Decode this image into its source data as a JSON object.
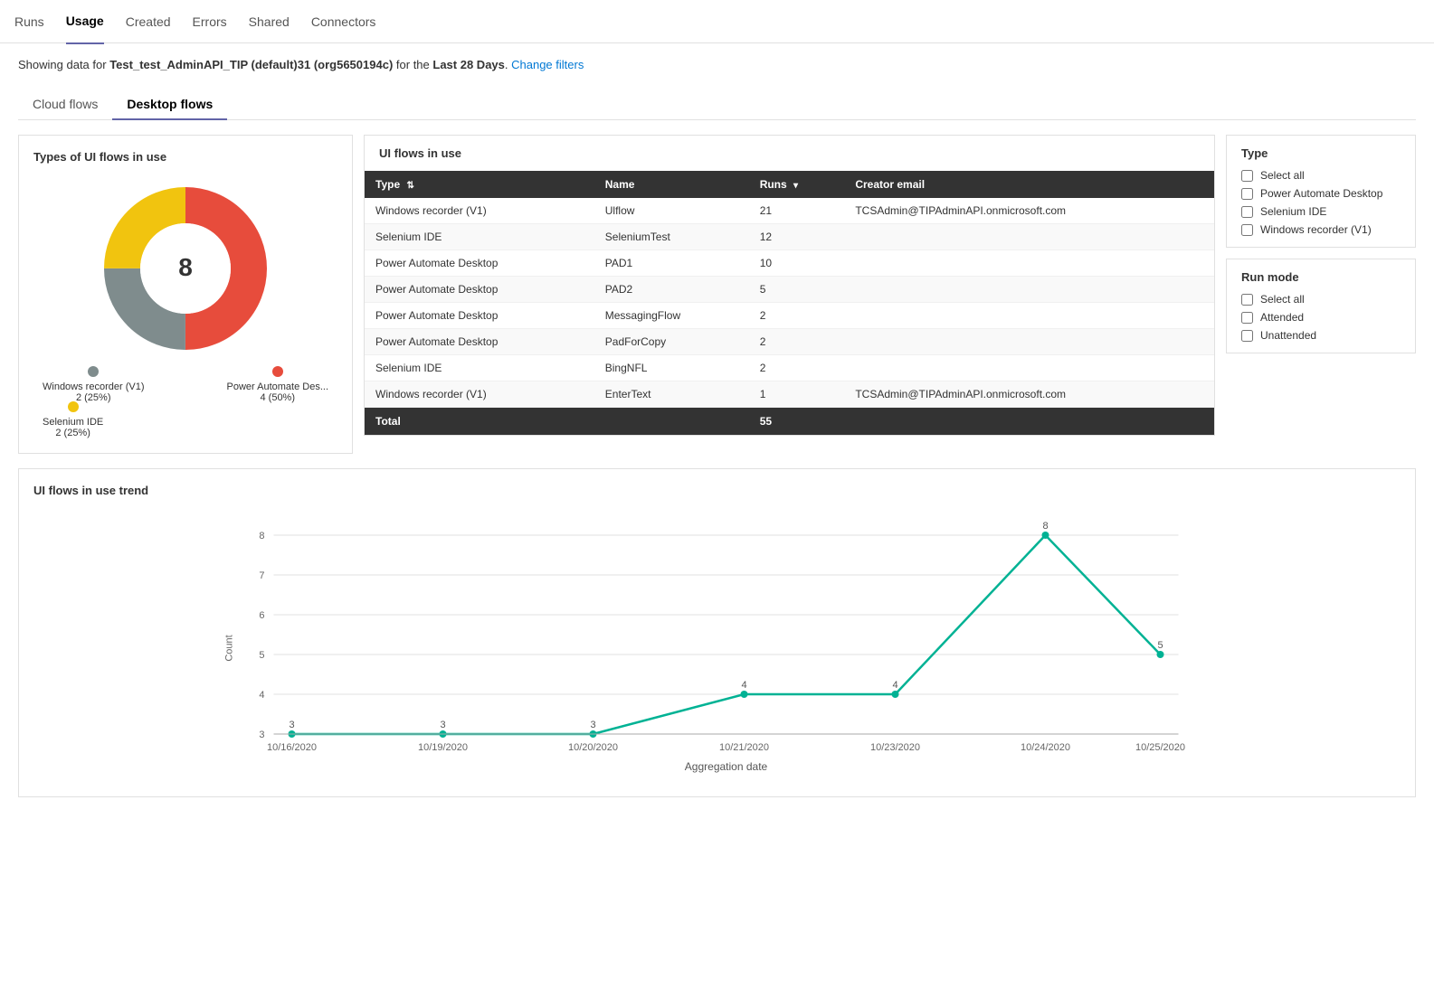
{
  "nav": {
    "items": [
      {
        "label": "Runs",
        "active": false
      },
      {
        "label": "Usage",
        "active": true
      },
      {
        "label": "Created",
        "active": false
      },
      {
        "label": "Errors",
        "active": false
      },
      {
        "label": "Shared",
        "active": false
      },
      {
        "label": "Connectors",
        "active": false
      }
    ]
  },
  "info_bar": {
    "prefix": "Showing data for",
    "env_name": "Test_test_AdminAPI_TIP (default)31 (org5650194c)",
    "middle": "for the",
    "period": "Last 28 Days",
    "suffix": ".",
    "change_link": "Change filters"
  },
  "tabs": [
    {
      "label": "Cloud flows",
      "active": false
    },
    {
      "label": "Desktop flows",
      "active": true
    }
  ],
  "donut": {
    "title": "Types of UI flows in use",
    "center_value": "8",
    "segments": [
      {
        "label": "Power Automate Des...",
        "sublabel": "4 (50%)",
        "color": "#e74c3c",
        "value": 50,
        "offset": 0
      },
      {
        "label": "Windows recorder (V1)",
        "sublabel": "2 (25%)",
        "color": "#7f8c8d",
        "value": 25,
        "offset": 50
      },
      {
        "label": "Selenium IDE",
        "sublabel": "2 (25%)",
        "color": "#f1c40f",
        "value": 25,
        "offset": 75
      }
    ]
  },
  "table": {
    "title": "UI flows in use",
    "columns": [
      "Type",
      "Name",
      "Runs",
      "Creator email"
    ],
    "rows": [
      {
        "type": "Windows recorder (V1)",
        "name": "Ulflow",
        "runs": "21",
        "email": "TCSAdmin@TIPAdminAPI.onmicrosoft.com"
      },
      {
        "type": "Selenium IDE",
        "name": "SeleniumTest",
        "runs": "12",
        "email": ""
      },
      {
        "type": "Power Automate Desktop",
        "name": "PAD1",
        "runs": "10",
        "email": ""
      },
      {
        "type": "Power Automate Desktop",
        "name": "PAD2",
        "runs": "5",
        "email": ""
      },
      {
        "type": "Power Automate Desktop",
        "name": "MessagingFlow",
        "runs": "2",
        "email": ""
      },
      {
        "type": "Power Automate Desktop",
        "name": "PadForCopy",
        "runs": "2",
        "email": ""
      },
      {
        "type": "Selenium IDE",
        "name": "BingNFL",
        "runs": "2",
        "email": ""
      },
      {
        "type": "Windows recorder (V1)",
        "name": "EnterText",
        "runs": "1",
        "email": "TCSAdmin@TIPAdminAPI.onmicrosoft.com"
      }
    ],
    "footer": {
      "label": "Total",
      "value": "55"
    }
  },
  "type_filter": {
    "title": "Type",
    "items": [
      {
        "label": "Select all",
        "checked": false
      },
      {
        "label": "Power Automate Desktop",
        "checked": false
      },
      {
        "label": "Selenium IDE",
        "checked": false
      },
      {
        "label": "Windows recorder (V1)",
        "checked": false
      }
    ]
  },
  "run_mode_filter": {
    "title": "Run mode",
    "items": [
      {
        "label": "Select all",
        "checked": false
      },
      {
        "label": "Attended",
        "checked": false
      },
      {
        "label": "Unattended",
        "checked": false
      }
    ]
  },
  "trend": {
    "title": "UI flows in use trend",
    "y_label": "Count",
    "x_label": "Aggregation date",
    "points": [
      {
        "date": "10/16/2020",
        "value": 3
      },
      {
        "date": "10/19/2020",
        "value": 3
      },
      {
        "date": "10/20/2020",
        "value": 3
      },
      {
        "date": "10/21/2020",
        "value": 4
      },
      {
        "date": "10/23/2020",
        "value": 4
      },
      {
        "date": "10/24/2020",
        "value": 8
      },
      {
        "date": "10/25/2020",
        "value": 5
      }
    ],
    "y_min": 3,
    "y_max": 8,
    "y_ticks": [
      3,
      4,
      5,
      6,
      7,
      8
    ]
  }
}
